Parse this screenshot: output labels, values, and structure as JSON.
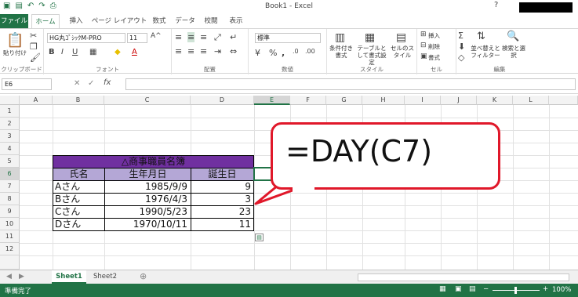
{
  "window": {
    "title": "Book1 - Excel"
  },
  "ribbon_tabs": [
    "ファイル",
    "ホーム",
    "挿入",
    "ページ レイアウト",
    "数式",
    "データ",
    "校閲",
    "表示"
  ],
  "ribbon": {
    "clipboard": {
      "paste": "貼り付け",
      "label": "クリップボード"
    },
    "font": {
      "font_name": "HG丸ｺﾞｼｯｸM-PRO",
      "font_size": "11",
      "label": "フォント"
    },
    "alignment": {
      "label": "配置"
    },
    "number": {
      "format": "標準",
      "label": "数値"
    },
    "styles": {
      "conditional": "条件付き書式",
      "table": "テーブルとして書式設定",
      "cell_styles": "セルのスタイル",
      "label": "スタイル"
    },
    "cells": {
      "insert": "挿入",
      "delete": "削除",
      "format": "書式",
      "label": "セル"
    },
    "editing": {
      "sort": "並べ替えとフィルター",
      "find": "検索と選択",
      "label": "編集"
    }
  },
  "formula_bar": {
    "name_box": "E6",
    "fx": "fx",
    "value": ""
  },
  "columns": [
    "A",
    "B",
    "C",
    "D",
    "E",
    "F",
    "G",
    "H",
    "I",
    "J",
    "K",
    "L"
  ],
  "rows": [
    "1",
    "2",
    "3",
    "4",
    "5",
    "6",
    "7",
    "8",
    "9",
    "10",
    "11",
    "12"
  ],
  "table": {
    "title": "△商事職員名簿",
    "headers": [
      "氏名",
      "生年月日",
      "誕生日"
    ],
    "rows": [
      [
        "Aさん",
        "1985/9/9",
        "9"
      ],
      [
        "Bさん",
        "1976/4/3",
        "3"
      ],
      [
        "Cさん",
        "1990/5/23",
        "23"
      ],
      [
        "Dさん",
        "1970/10/11",
        "11"
      ]
    ]
  },
  "callout": {
    "text": "=DAY(C7)"
  },
  "sheets": [
    "Sheet1",
    "Sheet2"
  ],
  "status": {
    "ready": "準備完了",
    "zoom": "100%"
  },
  "colors": {
    "accent": "#217346",
    "header_fill": "#7030a0",
    "callout_border": "#e0182a"
  }
}
